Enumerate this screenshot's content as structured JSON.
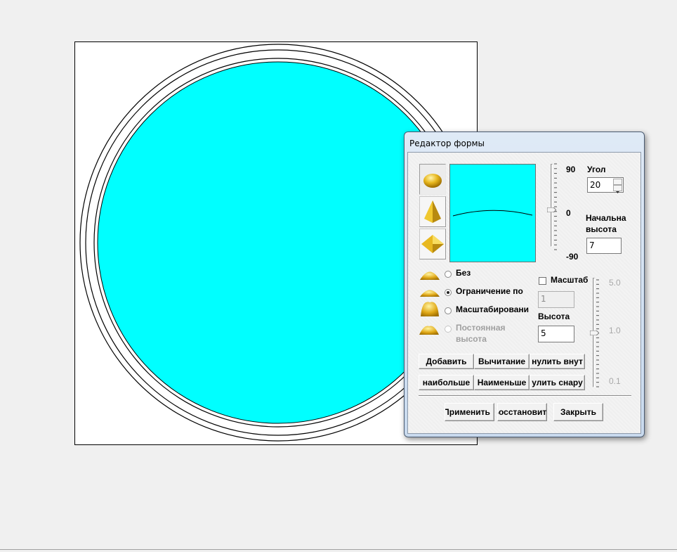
{
  "dialog": {
    "title": "Редактор формы",
    "angle": {
      "label": "Угол",
      "value": "20"
    },
    "start_height": {
      "label_line1": "Начальна",
      "label_line2": "высота",
      "value": "7"
    },
    "vertical_slider": {
      "top": "90",
      "middle": "0",
      "bottom": "-90",
      "level": 0.5
    },
    "profile_options": [
      {
        "label": "Без",
        "checked": false,
        "disabled": false
      },
      {
        "label": "Ограничение по",
        "checked": true,
        "disabled": false
      },
      {
        "label": "Масштабировани",
        "checked": false,
        "disabled": false
      },
      {
        "label_line1": "Постоянная",
        "label_line2": "высота",
        "checked": false,
        "disabled": true
      }
    ],
    "scale": {
      "label": "Масштаб",
      "value": "1"
    },
    "height": {
      "label": "Высота",
      "value": "5"
    },
    "scale_slider": {
      "top": "5.0",
      "middle": "1.0",
      "bottom": "0.1"
    },
    "buttons_row1": [
      "Добавить",
      "Вычитание",
      "нулить внут"
    ],
    "buttons_row2": [
      "наибольше",
      "Наименьше",
      "улить снару"
    ],
    "footer_buttons": {
      "apply": "Применить",
      "restore": "Восстановить",
      "close": "Закрыть"
    }
  },
  "colors": {
    "fill": "#00ffff",
    "accent": "#e0b020"
  }
}
